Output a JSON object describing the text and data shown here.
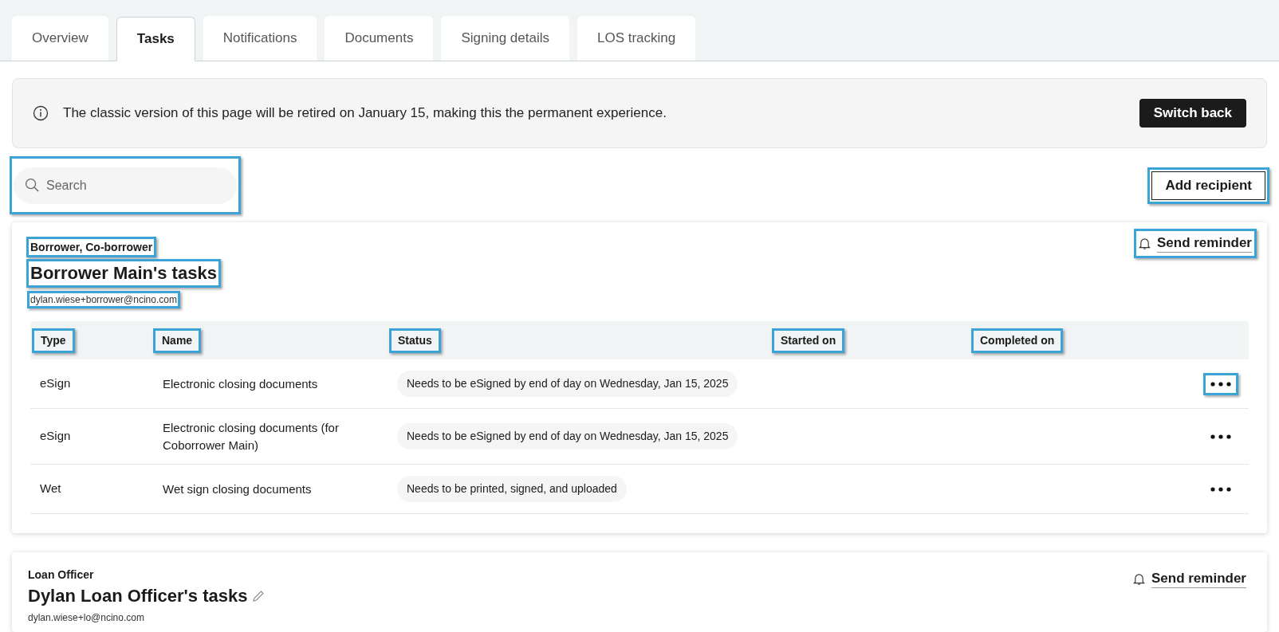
{
  "tabs": [
    {
      "label": "Overview",
      "selected": false
    },
    {
      "label": "Tasks",
      "selected": true
    },
    {
      "label": "Notifications",
      "selected": false
    },
    {
      "label": "Documents",
      "selected": false
    },
    {
      "label": "Signing details",
      "selected": false
    },
    {
      "label": "LOS tracking",
      "selected": false
    }
  ],
  "banner": {
    "message": "The classic version of this page will be retired on January 15, making this the permanent experience.",
    "button": "Switch back"
  },
  "search": {
    "placeholder": "Search",
    "highlighted": true
  },
  "add_recipient": {
    "label": "Add recipient",
    "highlighted": true
  },
  "cards": [
    {
      "role": {
        "text": "Borrower, Co-borrower",
        "highlighted": true
      },
      "title": {
        "text": "Borrower Main's tasks",
        "highlighted": true,
        "editable": false
      },
      "email": {
        "text": "dylan.wiese+borrower@ncino.com",
        "highlighted": true
      },
      "reminder": {
        "label": "Send reminder",
        "highlighted": true
      },
      "table": {
        "columns": [
          {
            "label": "Type",
            "highlighted": true
          },
          {
            "label": "Name",
            "highlighted": true
          },
          {
            "label": "Status",
            "highlighted": true
          },
          {
            "label": "Started on",
            "highlighted": true
          },
          {
            "label": "Completed on",
            "highlighted": true
          }
        ],
        "rows": [
          {
            "type": "eSign",
            "name": "Electronic closing documents",
            "status": "Needs to be eSigned by end of day on Wednesday, Jan 15, 2025",
            "menu_highlighted": true
          },
          {
            "type": "eSign",
            "name": "Electronic closing documents (for Coborrower Main)",
            "status": "Needs to be eSigned by end of day on Wednesday, Jan 15, 2025",
            "menu_highlighted": false
          },
          {
            "type": "Wet",
            "name": "Wet sign closing documents",
            "status": "Needs to be printed, signed, and uploaded",
            "menu_highlighted": false
          }
        ]
      }
    },
    {
      "role": {
        "text": "Loan Officer",
        "highlighted": false
      },
      "title": {
        "text": "Dylan Loan Officer's tasks",
        "highlighted": false,
        "editable": true
      },
      "email": {
        "text": "dylan.wiese+lo@ncino.com",
        "highlighted": false
      },
      "reminder": {
        "label": "Send reminder",
        "highlighted": false
      }
    }
  ]
}
